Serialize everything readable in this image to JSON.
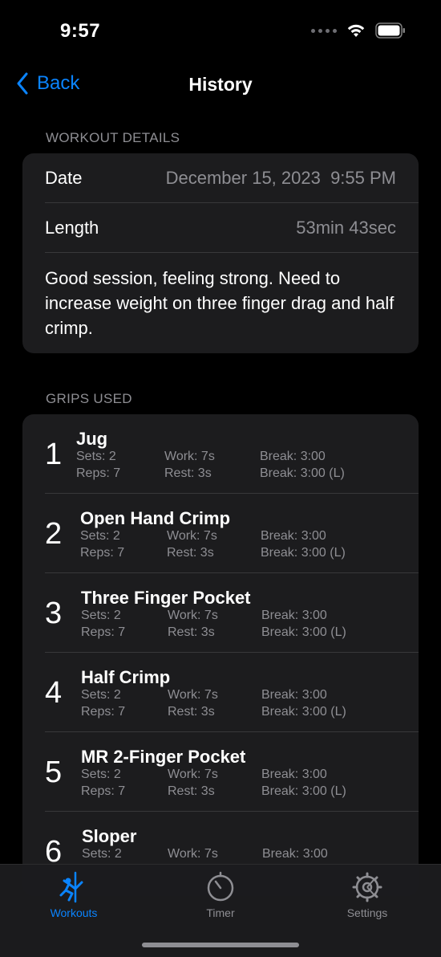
{
  "status_bar": {
    "time": "9:57"
  },
  "nav": {
    "back_label": "Back",
    "title": "History"
  },
  "details": {
    "header": "WORKOUT DETAILS",
    "date_label": "Date",
    "date_value": "December 15, 2023  9:55 PM",
    "length_label": "Length",
    "length_value": "53min 43sec",
    "notes": "Good session, feeling strong. Need to increase weight on three finger drag and half crimp."
  },
  "grips": {
    "header": "GRIPS USED",
    "items": [
      {
        "number": "1",
        "name": "Jug",
        "sets": "Sets: 2",
        "reps": "Reps: 7",
        "work": "Work: 7s",
        "rest": "Rest: 3s",
        "break": "Break: 3:00",
        "last_break": "Break: 3:00 (L)"
      },
      {
        "number": "2",
        "name": "Open Hand Crimp",
        "sets": "Sets: 2",
        "reps": "Reps: 7",
        "work": "Work: 7s",
        "rest": "Rest: 3s",
        "break": "Break: 3:00",
        "last_break": "Break: 3:00 (L)"
      },
      {
        "number": "3",
        "name": "Three Finger Pocket",
        "sets": "Sets: 2",
        "reps": "Reps: 7",
        "work": "Work: 7s",
        "rest": "Rest: 3s",
        "break": "Break: 3:00",
        "last_break": "Break: 3:00 (L)"
      },
      {
        "number": "4",
        "name": "Half Crimp",
        "sets": "Sets: 2",
        "reps": "Reps: 7",
        "work": "Work: 7s",
        "rest": "Rest: 3s",
        "break": "Break: 3:00",
        "last_break": "Break: 3:00 (L)"
      },
      {
        "number": "5",
        "name": "MR 2-Finger Pocket",
        "sets": "Sets: 2",
        "reps": "Reps: 7",
        "work": "Work: 7s",
        "rest": "Rest: 3s",
        "break": "Break: 3:00",
        "last_break": "Break: 3:00 (L)"
      },
      {
        "number": "6",
        "name": "Sloper",
        "sets": "Sets: 2",
        "work": "Work: 7s",
        "break": "Break: 3:00"
      }
    ]
  },
  "tab_bar": {
    "tabs": [
      {
        "label": "Workouts",
        "icon": "climber-icon",
        "active": true
      },
      {
        "label": "Timer",
        "icon": "timer-icon",
        "active": false
      },
      {
        "label": "Settings",
        "icon": "gear-icon",
        "active": false
      }
    ]
  },
  "colors": {
    "accent": "#0a84ff",
    "background": "#000000",
    "card": "#1c1c1e",
    "secondary_text": "#8e8e93"
  }
}
